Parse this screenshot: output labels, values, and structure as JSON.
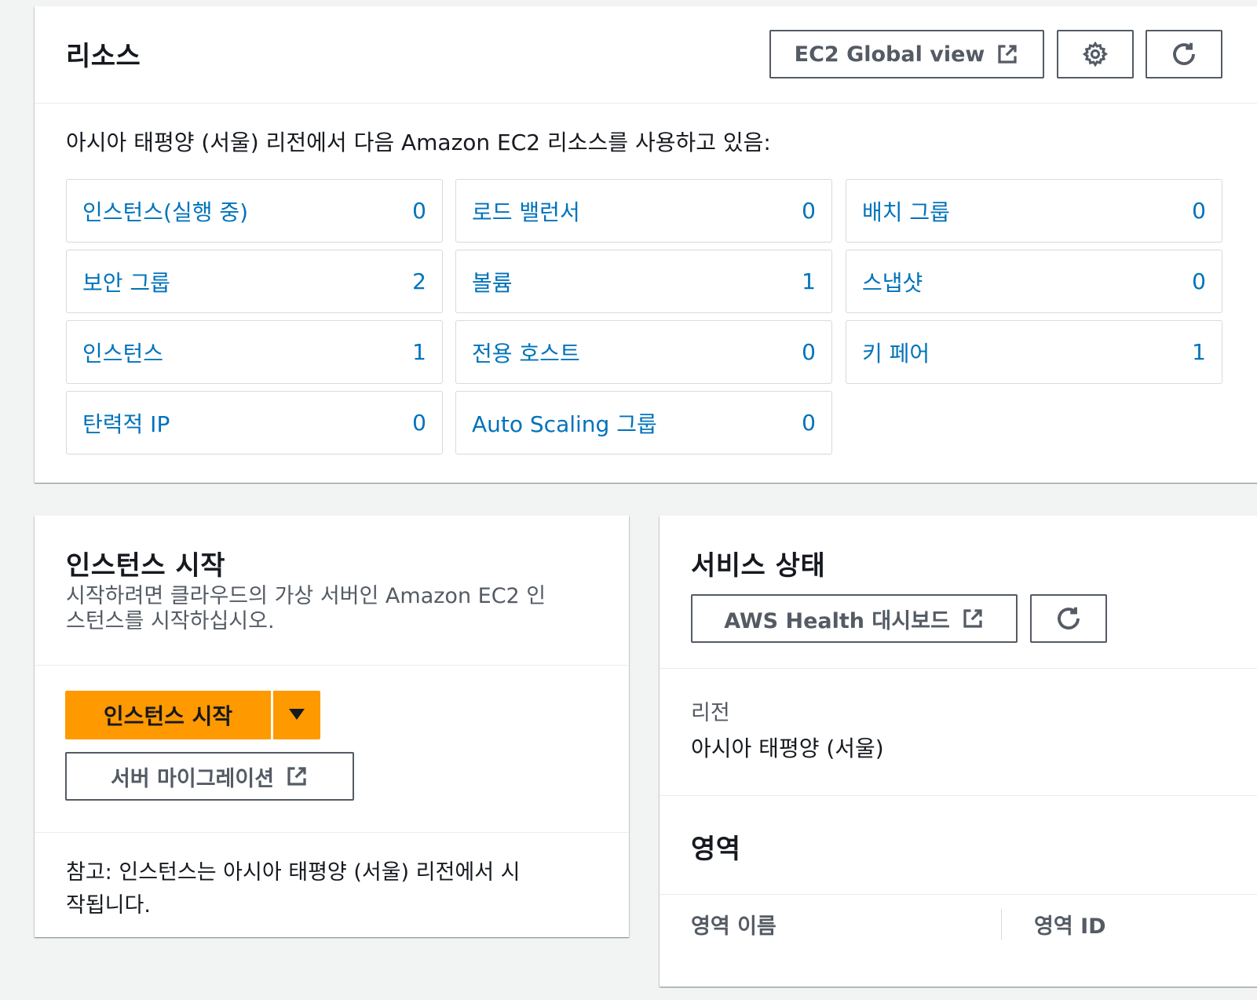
{
  "resources": {
    "title": "리소스",
    "global_view_label": "EC2 Global view",
    "description": "아시아 태평양 (서울) 리전에서 다음 Amazon EC2 리소스를 사용하고 있음:",
    "items": [
      {
        "label": "인스턴스(실행 중)",
        "count": "0"
      },
      {
        "label": "로드 밸런서",
        "count": "0"
      },
      {
        "label": "배치 그룹",
        "count": "0"
      },
      {
        "label": "보안 그룹",
        "count": "2"
      },
      {
        "label": "볼륨",
        "count": "1"
      },
      {
        "label": "스냅샷",
        "count": "0"
      },
      {
        "label": "인스턴스",
        "count": "1"
      },
      {
        "label": "전용 호스트",
        "count": "0"
      },
      {
        "label": "키 페어",
        "count": "1"
      },
      {
        "label": "탄력적 IP",
        "count": "0"
      },
      {
        "label": "Auto Scaling 그룹",
        "count": "0"
      }
    ]
  },
  "launch": {
    "title": "인스턴스 시작",
    "description_line1": "시작하려면 클라우드의 가상 서버인 Amazon EC2 인",
    "description_line2": "스턴스를 시작하십시오.",
    "launch_button": "인스턴스 시작",
    "migration_button": "서버 마이그레이션",
    "note_line1": "참고: 인스턴스는 아시아 태평양 (서울) 리전에서 시",
    "note_line2": "작됩니다."
  },
  "service_health": {
    "title": "서비스 상태",
    "health_button": "AWS Health 대시보드",
    "region_label": "리전",
    "region_value": "아시아 태평양 (서울)",
    "zones_title": "영역",
    "col_zone_name": "영역 이름",
    "col_zone_id": "영역 ID"
  },
  "colors": {
    "link": "#0073bb",
    "primary": "#ff9900",
    "border": "#545b64"
  }
}
